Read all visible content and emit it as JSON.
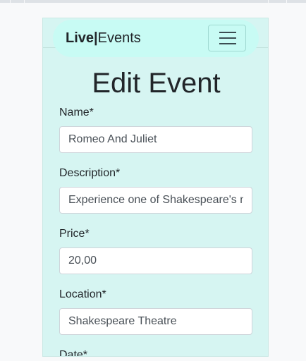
{
  "navbar": {
    "brand_bold": "Live",
    "brand_separator": "|",
    "brand_light": "Events",
    "toggler_icon": "hamburger-menu-icon"
  },
  "page": {
    "title": "Edit Event"
  },
  "form": {
    "name": {
      "label": "Name*",
      "value": "Romeo And Juliet"
    },
    "description": {
      "label": "Description*",
      "value": "Experience one of Shakespeare's most famous tragedies"
    },
    "price": {
      "label": "Price*",
      "value": "20,00"
    },
    "location": {
      "label": "Location*",
      "value": "Shakespeare Theatre"
    },
    "date": {
      "label": "Date*"
    }
  },
  "colors": {
    "card_background": "#d6f5f2",
    "nav_pill": "#c8fbf4",
    "page_background": "#f8f9fa"
  }
}
